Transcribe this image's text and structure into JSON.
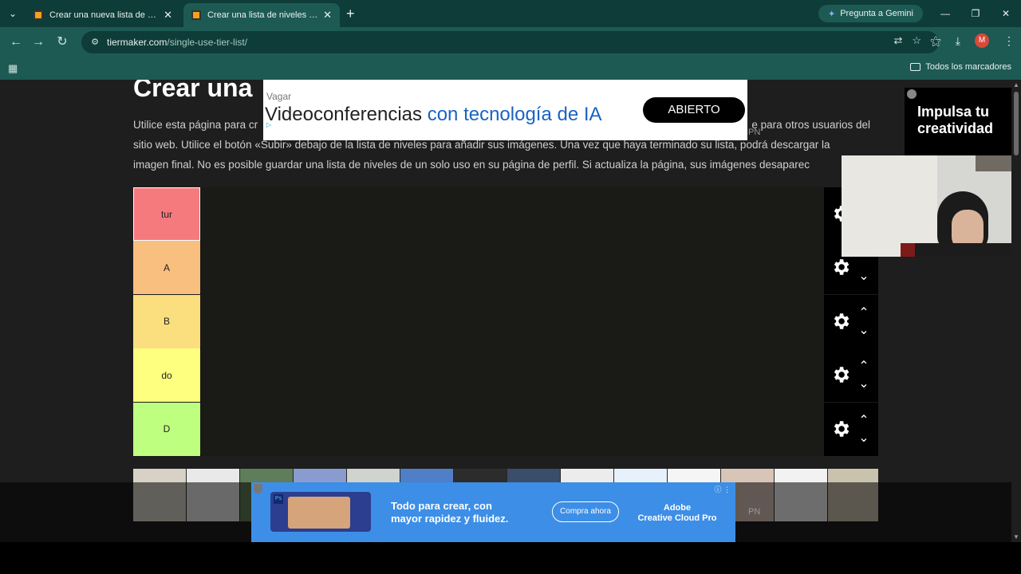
{
  "browser": {
    "tabs": [
      {
        "title": "Crear una nueva lista de niveles"
      },
      {
        "title": "Crear una lista de niveles de un"
      }
    ],
    "gemini_label": "Pregunta a Gemini",
    "url_domain": "tiermaker.com",
    "url_path": "/single-use-tier-list/",
    "profile_initial": "M",
    "bookmarks_label": "Todos los marcadores"
  },
  "page": {
    "title": "Crear una",
    "intro_lines": [
      "Utilice esta página para cr",
      "e para otros usuarios del",
      "sitio web. Utilice el botón «Subir» debajo de la lista de niveles para añadir sus imágenes. Una vez que haya terminado su lista, podrá descargar la",
      "imagen final. No es posible guardar una lista de niveles de un solo uso en su página de perfil. Si actualiza la página, sus imágenes desaparec"
    ]
  },
  "ad_top": {
    "brand": "Vagar",
    "headline_a": "Videoconferencias ",
    "headline_b": "con tecnología de IA",
    "cta": "ABIERTO"
  },
  "ad_right": {
    "text": "Impulsa tu creatividad"
  },
  "tiers": [
    {
      "label": "tur",
      "color": "#f57a7e",
      "selected": true
    },
    {
      "label": "A",
      "color": "#f9bf7e"
    },
    {
      "label": "B",
      "color": "#fbdf7f"
    },
    {
      "label": "do",
      "color": "#fefe7f"
    },
    {
      "label": "D",
      "color": "#bfff7f"
    }
  ],
  "ad_bottom": {
    "message_line1": "Todo para crear, con",
    "message_line2": "mayor rapidez y fluidez.",
    "cta": "Compra ahora",
    "brand_line1": "Adobe",
    "brand_line2": "Creative Cloud Pro",
    "ps_logo": "Ps"
  },
  "pn_label": "PN",
  "icons": {
    "gear": "gear-icon",
    "up": "chevron-up-icon",
    "down": "chevron-down-icon"
  }
}
